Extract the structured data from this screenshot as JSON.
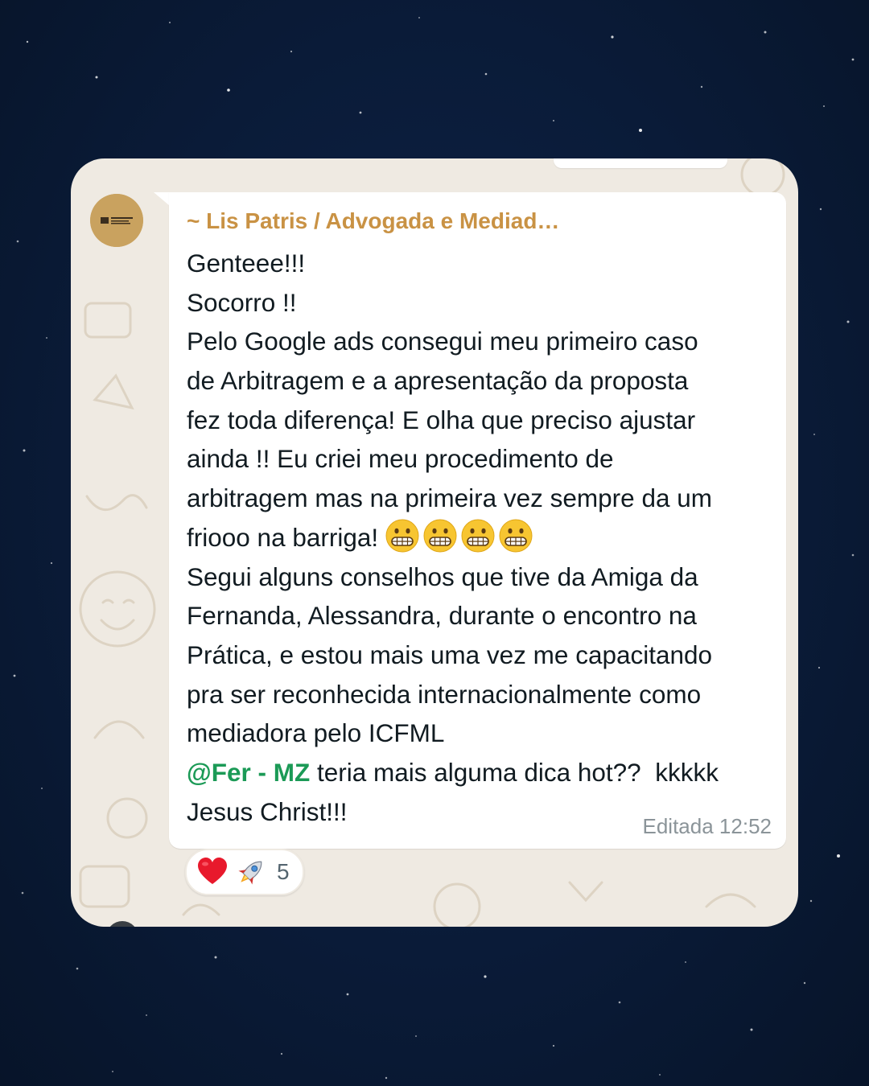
{
  "chat": {
    "sender_name": "~ Lis Patris / Advogada e Mediad…",
    "avatar_icon": "law-office-logo-avatar",
    "message_lines": [
      "Genteee!!!",
      "Socorro !!",
      "Pelo Google ads consegui meu primeiro caso",
      "de Arbitragem e a apresentação da proposta",
      "fez toda diferença! E olha que preciso ajustar",
      "ainda !!  Eu criei meu procedimento de",
      "arbitragem mas na primeira vez sempre da um"
    ],
    "emoji_line_text": "friooo na barriga!",
    "emoji_line_icons": [
      "grimacing-face-icon",
      "grimacing-face-icon",
      "grimacing-face-icon",
      "grimacing-face-icon"
    ],
    "message_lines_2": [
      "Segui alguns conselhos que tive da Amiga da",
      "Fernanda, Alessandra, durante o encontro na",
      "Prática, e estou mais uma vez me capacitando",
      "pra ser reconhecida internacionalmente como",
      "mediadora pelo ICFML"
    ],
    "mention": "@Fer - MZ",
    "mention_line_rest": " teria mais alguma dica hot??  kkkkk",
    "last_line": "Jesus Christ!!!",
    "edited_label": "Editada",
    "time": "12:52"
  },
  "reactions": {
    "icons": [
      "heart-icon",
      "rocket-icon"
    ],
    "count": "5"
  },
  "colors": {
    "background": "#0a1b38",
    "chat_wallpaper": "#efeae2",
    "bubble": "#ffffff",
    "sender": "#c99244",
    "mention": "#1b9a56",
    "meta": "#8b9499"
  }
}
